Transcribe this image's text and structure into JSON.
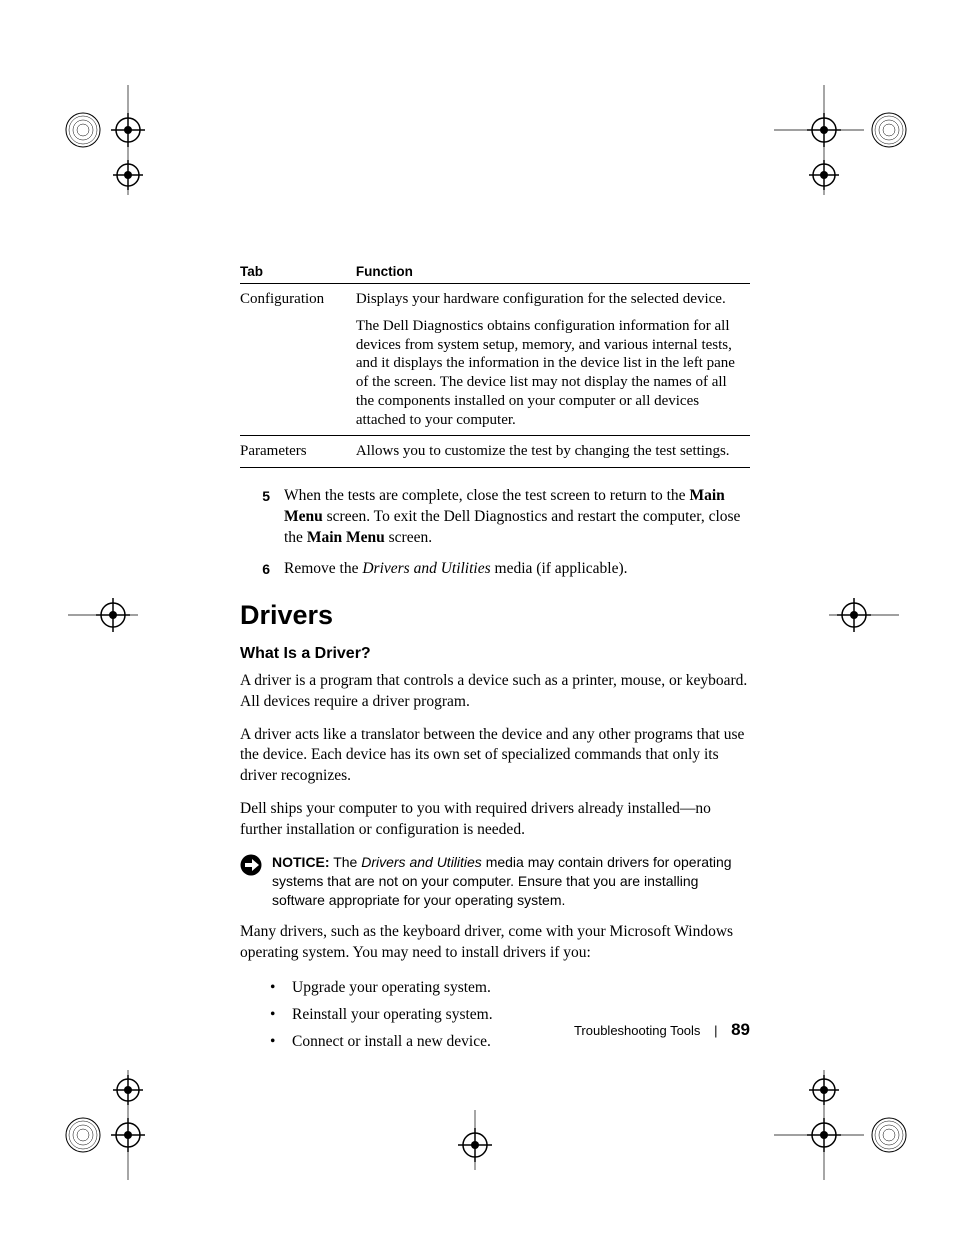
{
  "table": {
    "headers": {
      "tab": "Tab",
      "function": "Function"
    },
    "rows": [
      {
        "tab": "Configuration",
        "func1": "Displays your hardware configuration for the selected device.",
        "func2": "The Dell Diagnostics obtains configuration information for all devices from system setup, memory, and various internal tests, and it displays the information in the device list in the left pane of the screen. The device list may not display the names of all the components installed on your computer or all devices attached to your computer."
      },
      {
        "tab": "Parameters",
        "func1": "Allows you to customize the test by changing the test settings."
      }
    ]
  },
  "steps": {
    "s5": {
      "num": "5",
      "t1": "When the tests are complete, close the test screen to return to the ",
      "b1": "Main Menu",
      "t2": " screen. To exit the Dell Diagnostics and restart the computer, close the ",
      "b2": "Main Menu",
      "t3": " screen."
    },
    "s6": {
      "num": "6",
      "t1": "Remove the ",
      "i1": "Drivers and Utilities",
      "t2": " media (if applicable)."
    }
  },
  "section": "Drivers",
  "subsection": "What Is a Driver?",
  "paras": {
    "p1": "A driver is a program that controls a device such as a printer, mouse, or keyboard. All devices require a driver program.",
    "p2": "A driver acts like a translator between the device and any other programs that use the device. Each device has its own set of specialized commands that only its driver recognizes.",
    "p3": "Dell ships your computer to you with required drivers already installed—no further installation or configuration is needed.",
    "p4": "Many drivers, such as the keyboard driver, come with your Microsoft Windows operating system. You may need to install drivers if you:"
  },
  "notice": {
    "label": "NOTICE:",
    "t1": " The ",
    "i1": "Drivers and Utilities",
    "t2": " media may contain drivers for operating systems that are not on your computer. Ensure that you are installing software appropriate for your operating system."
  },
  "bullets": {
    "b1": "Upgrade your operating system.",
    "b2": "Reinstall your operating system.",
    "b3": "Connect or install a new device."
  },
  "footer": {
    "section": "Troubleshooting Tools",
    "page": "89"
  }
}
